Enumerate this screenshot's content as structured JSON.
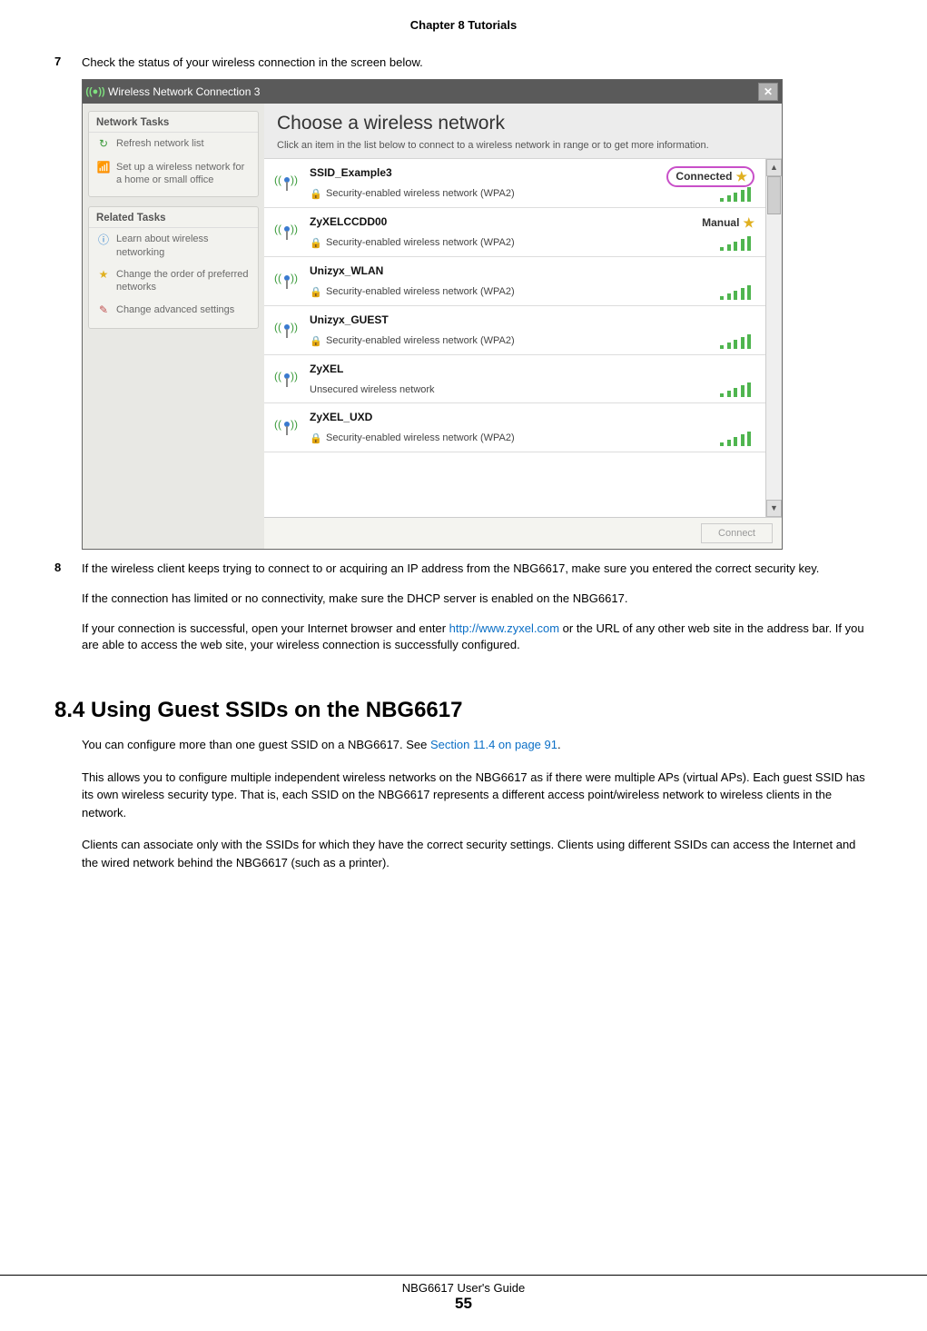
{
  "header": "Chapter 8 Tutorials",
  "steps": {
    "s7": {
      "num": "7",
      "text": "Check the status of your wireless connection in the screen below."
    },
    "s8": {
      "num": "8",
      "p1": "If the wireless client keeps trying to connect to or acquiring an IP address from the NBG6617, make sure you entered the correct security key.",
      "p2": "If the connection has limited or no connectivity, make sure the DHCP server is enabled on the NBG6617.",
      "p3a": "If your connection is successful, open your Internet browser and enter ",
      "p3link": "http://www.zyxel.com",
      "p3b": " or the URL of any other web site in the address bar. If you are able to access the web site, your wireless connection is successfully configured."
    }
  },
  "dialog": {
    "title": "Wireless Network Connection 3",
    "sidebar": {
      "group1": {
        "title": "Network Tasks",
        "items": [
          "Refresh network list",
          "Set up a wireless network for a home or small office"
        ]
      },
      "group2": {
        "title": "Related Tasks",
        "items": [
          "Learn about wireless networking",
          "Change the order of preferred networks",
          "Change advanced settings"
        ]
      }
    },
    "main": {
      "title": "Choose a wireless network",
      "subtitle": "Click an item in the list below to connect to a wireless network in range or to get more information."
    },
    "networks": [
      {
        "ssid": "SSID_Example3",
        "security": "Security-enabled wireless network (WPA2)",
        "status": "Connected",
        "locked": true,
        "highlight": true
      },
      {
        "ssid": "ZyXELCCDD00",
        "security": "Security-enabled wireless network (WPA2)",
        "status": "Manual",
        "locked": true,
        "highlight": false
      },
      {
        "ssid": "Unizyx_WLAN",
        "security": "Security-enabled wireless network (WPA2)",
        "status": "",
        "locked": true,
        "highlight": false
      },
      {
        "ssid": "Unizyx_GUEST",
        "security": "Security-enabled wireless network (WPA2)",
        "status": "",
        "locked": true,
        "highlight": false
      },
      {
        "ssid": "ZyXEL",
        "security": "Unsecured wireless network",
        "status": "",
        "locked": false,
        "highlight": false
      },
      {
        "ssid": "ZyXEL_UXD",
        "security": "Security-enabled wireless network (WPA2)",
        "status": "",
        "locked": true,
        "highlight": false
      }
    ],
    "connect_label": "Connect"
  },
  "section": {
    "heading": "8.4  Using Guest SSIDs on the NBG6617",
    "p1a": "You can configure more than one guest SSID on a NBG6617. See ",
    "p1link": "Section 11.4 on page 91",
    "p1b": ".",
    "p2": "This allows you to configure multiple independent wireless networks on the NBG6617 as if there were multiple APs (virtual APs). Each guest SSID has its own wireless security type. That is, each SSID on the NBG6617 represents a different access point/wireless network to wireless clients in the network.",
    "p3": "Clients can associate only with the SSIDs for which they have the correct security settings. Clients using different SSIDs can access the Internet and the wired network behind the NBG6617 (such as a printer)."
  },
  "footer": {
    "guide": "NBG6617 User's Guide",
    "page": "55"
  }
}
